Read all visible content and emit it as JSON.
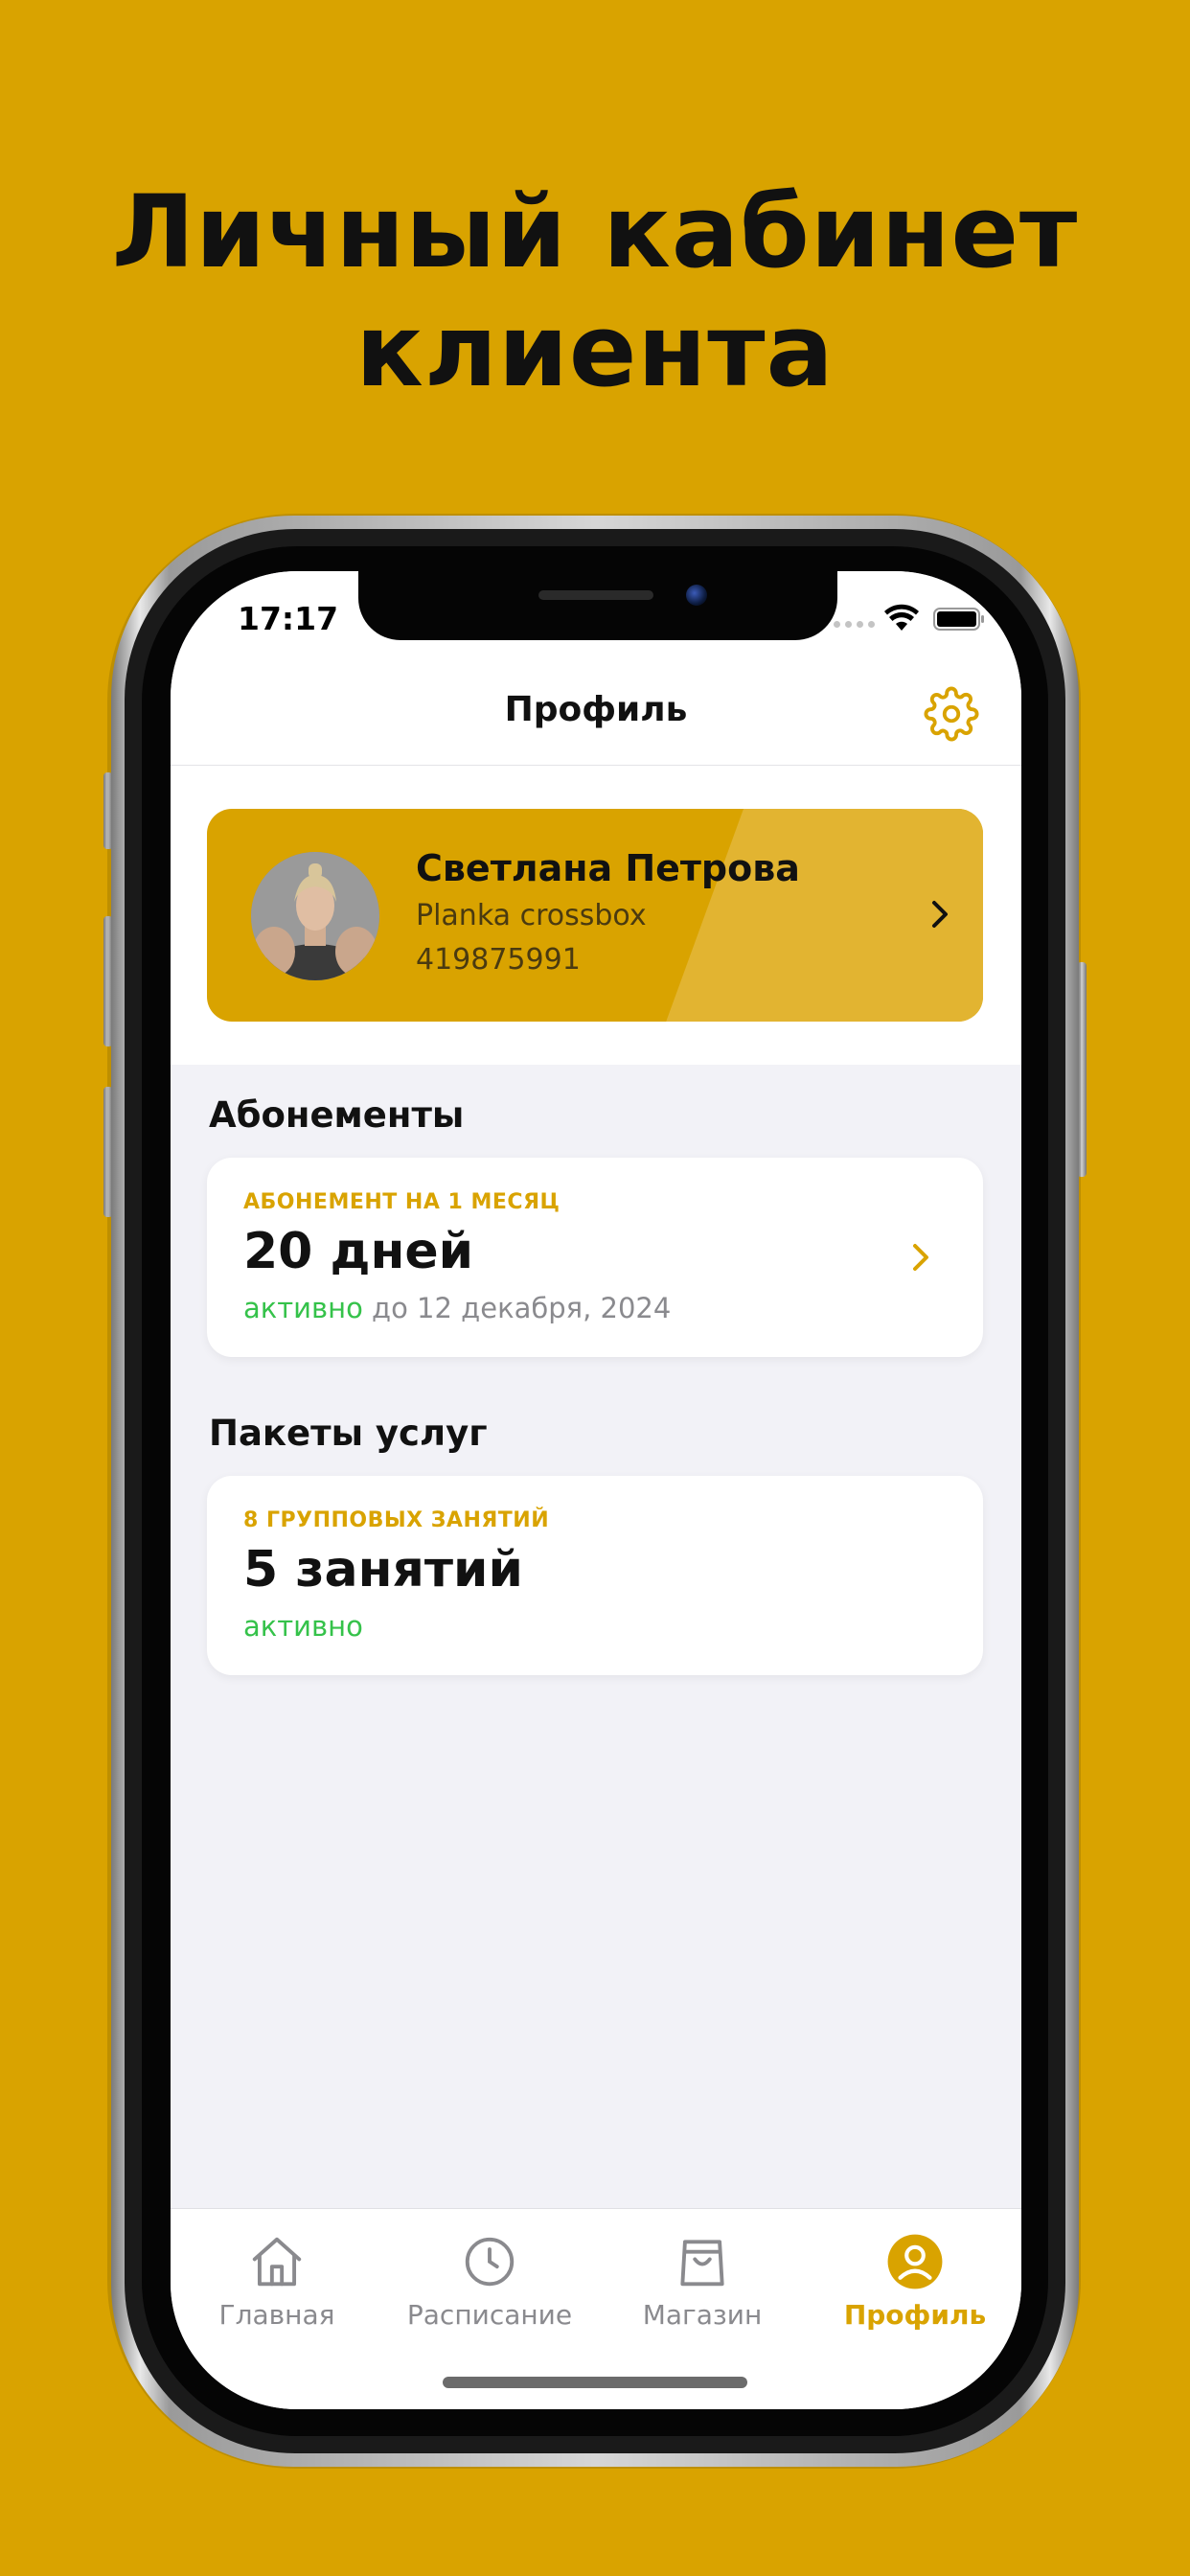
{
  "headline": {
    "line1": "Личный кабинет",
    "line2": "клиента"
  },
  "status_bar": {
    "time": "17:17"
  },
  "nav": {
    "title": "Профиль"
  },
  "profile": {
    "name": "Светлана Петрова",
    "club": "Planka crossbox",
    "id": "419875991"
  },
  "subscriptions": {
    "section_title": "Абонементы",
    "kicker": "АБОНЕМЕНТ НА 1 МЕСЯЦ",
    "value": "20 дней",
    "status": "активно",
    "until": "до 12 декабря, 2024"
  },
  "packages": {
    "section_title": "Пакеты услуг",
    "kicker": "8 ГРУППОВЫХ ЗАНЯТИЙ",
    "value": "5 занятий",
    "status": "активно"
  },
  "tabs": [
    {
      "label": "Главная",
      "icon": "home-icon"
    },
    {
      "label": "Расписание",
      "icon": "clock-icon"
    },
    {
      "label": "Магазин",
      "icon": "shopping-bag-icon"
    },
    {
      "label": "Профиль",
      "icon": "profile-icon"
    }
  ],
  "colors": {
    "accent": "#D9A300",
    "active_status": "#35C24A",
    "background": "#F2F2F7"
  }
}
